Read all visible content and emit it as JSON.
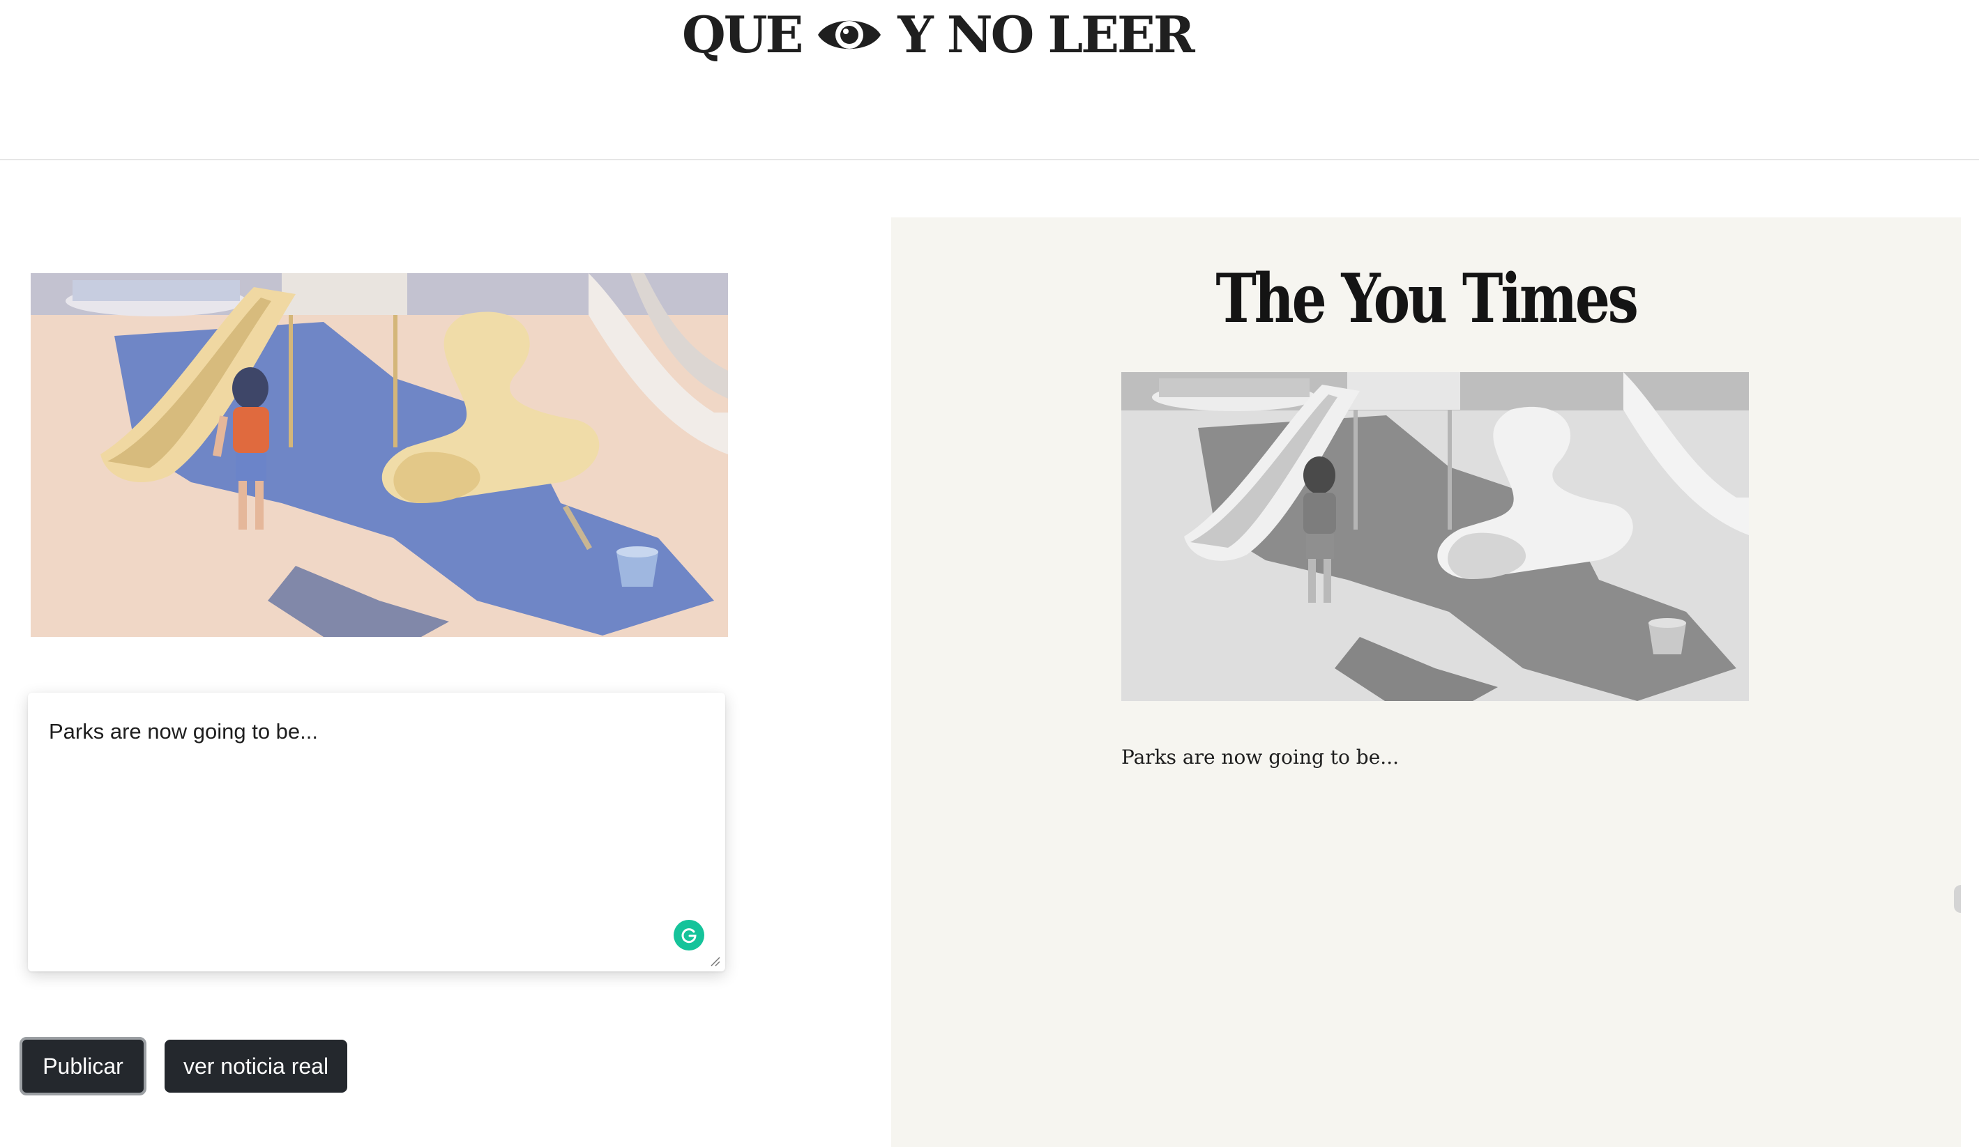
{
  "header": {
    "logo_left": "QUE",
    "logo_icon": "eye-icon",
    "logo_right": "Y NO LEER"
  },
  "editor": {
    "image_alt": "Child walking toward playground slides",
    "text": "Parks are now going to be...",
    "assistant_icon": "grammarly-icon"
  },
  "buttons": {
    "publish": "Publicar",
    "real_news": "ver noticia real"
  },
  "preview": {
    "masthead": "The You Times",
    "image_alt": "Grayscale child walking toward playground slides",
    "text": "Parks are now going to be..."
  },
  "colors": {
    "panel_bg": "#f6f5f0",
    "button_bg": "#24282d",
    "grammarly": "#15c39a",
    "illustration_sand": "#f1d8c8",
    "illustration_shadow": "#6f86c6"
  }
}
